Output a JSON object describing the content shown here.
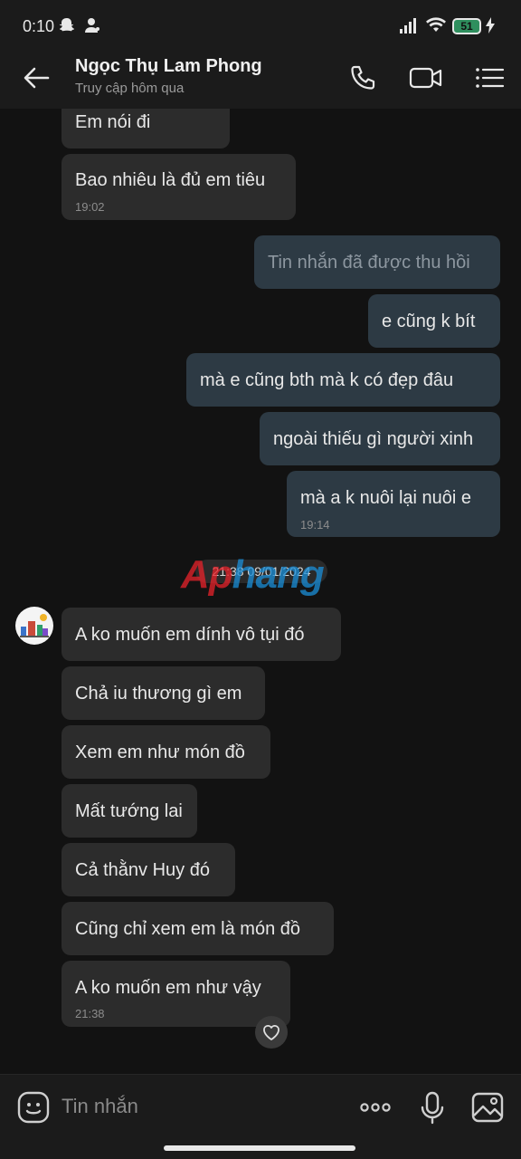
{
  "status_bar": {
    "time": "0:10",
    "battery": "51"
  },
  "header": {
    "contact_name": "Ngọc Thụ Lam Phong",
    "last_seen": "Truy cập hôm qua"
  },
  "messages": [
    {
      "text": "Em nói đi",
      "time": ""
    },
    {
      "text": "Bao nhiêu là đủ em tiêu",
      "time": "19:02"
    },
    {
      "text": "Tin nhắn đã được thu hồi",
      "time": ""
    },
    {
      "text": "e cũng k bít",
      "time": ""
    },
    {
      "text": "mà e cũng bth mà k có đẹp đâu",
      "time": ""
    },
    {
      "text": "ngoài thiếu gì người xinh",
      "time": ""
    },
    {
      "text": "mà a k nuôi lại nuôi e",
      "time": "19:14"
    },
    {
      "text": "A ko muốn em dính vô tụi đó",
      "time": ""
    },
    {
      "text": "Chả iu thương gì em",
      "time": ""
    },
    {
      "text": "Xem em như món đồ",
      "time": ""
    },
    {
      "text": "Mất tướng lai",
      "time": ""
    },
    {
      "text": "Cả thằnv Huy đó",
      "time": ""
    },
    {
      "text": "Cũng chỉ xem em là món đồ",
      "time": ""
    },
    {
      "text": "A ko muốn em như vậy",
      "time": "21:38"
    }
  ],
  "date_separator": "21:38 09/01/2024",
  "watermark": {
    "part1": "Ap",
    "part2": "hang"
  },
  "composer": {
    "placeholder": "Tin nhắn"
  },
  "icons": {
    "back": "back-arrow-icon",
    "call": "phone-icon",
    "video": "video-camera-icon",
    "menu": "list-menu-icon",
    "emoji": "emoji-icon",
    "more": "more-dots-icon",
    "mic": "microphone-icon",
    "image": "image-icon",
    "reaction": "heart-icon"
  },
  "colors": {
    "background": "#121212",
    "incoming_bubble": "#2c2c2c",
    "outgoing_bubble": "#2d3a44"
  }
}
